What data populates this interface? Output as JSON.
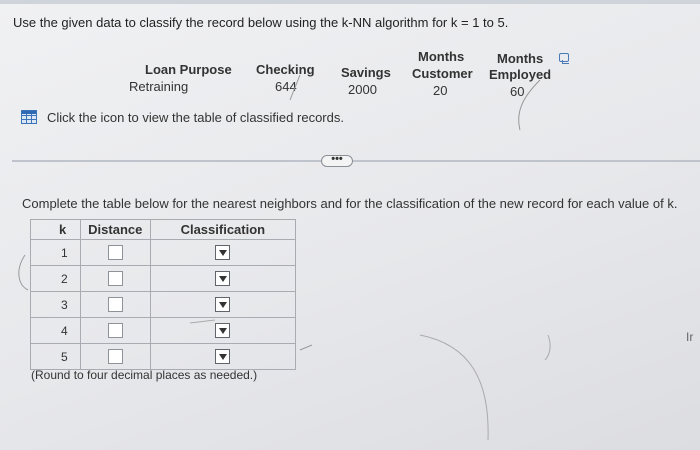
{
  "prompt": "Use the given data to classify the record below using the k-NN algorithm for k = 1 to 5.",
  "record": {
    "columns": [
      {
        "header_line1": "",
        "header_line2": "Loan Purpose",
        "value": "Retraining"
      },
      {
        "header_line1": "",
        "header_line2": "Checking",
        "value": "644"
      },
      {
        "header_line1": "",
        "header_line2": "Savings",
        "value": "2000"
      },
      {
        "header_line1": "Months",
        "header_line2": "Customer",
        "value": "20"
      },
      {
        "header_line1": "Months",
        "header_line2": "Employed",
        "value": "60"
      }
    ]
  },
  "icon_link_text": "Click the icon to view the table of classified records.",
  "more_button_label": "•••",
  "instruction": "Complete the table below for the nearest neighbors and for the classification of the new record for each value of k.",
  "table": {
    "headers": {
      "k": "k",
      "distance": "Distance",
      "classification": "Classification"
    },
    "rows": [
      {
        "k": "1",
        "distance": "",
        "classification": ""
      },
      {
        "k": "2",
        "distance": "",
        "classification": ""
      },
      {
        "k": "3",
        "distance": "",
        "classification": ""
      },
      {
        "k": "4",
        "distance": "",
        "classification": ""
      },
      {
        "k": "5",
        "distance": "",
        "classification": ""
      }
    ]
  },
  "round_note": "(Round to four decimal places as needed.)",
  "side_text": "Ir",
  "colors": {
    "icon_blue": "#2f69b3",
    "background": "#e9eaed"
  }
}
